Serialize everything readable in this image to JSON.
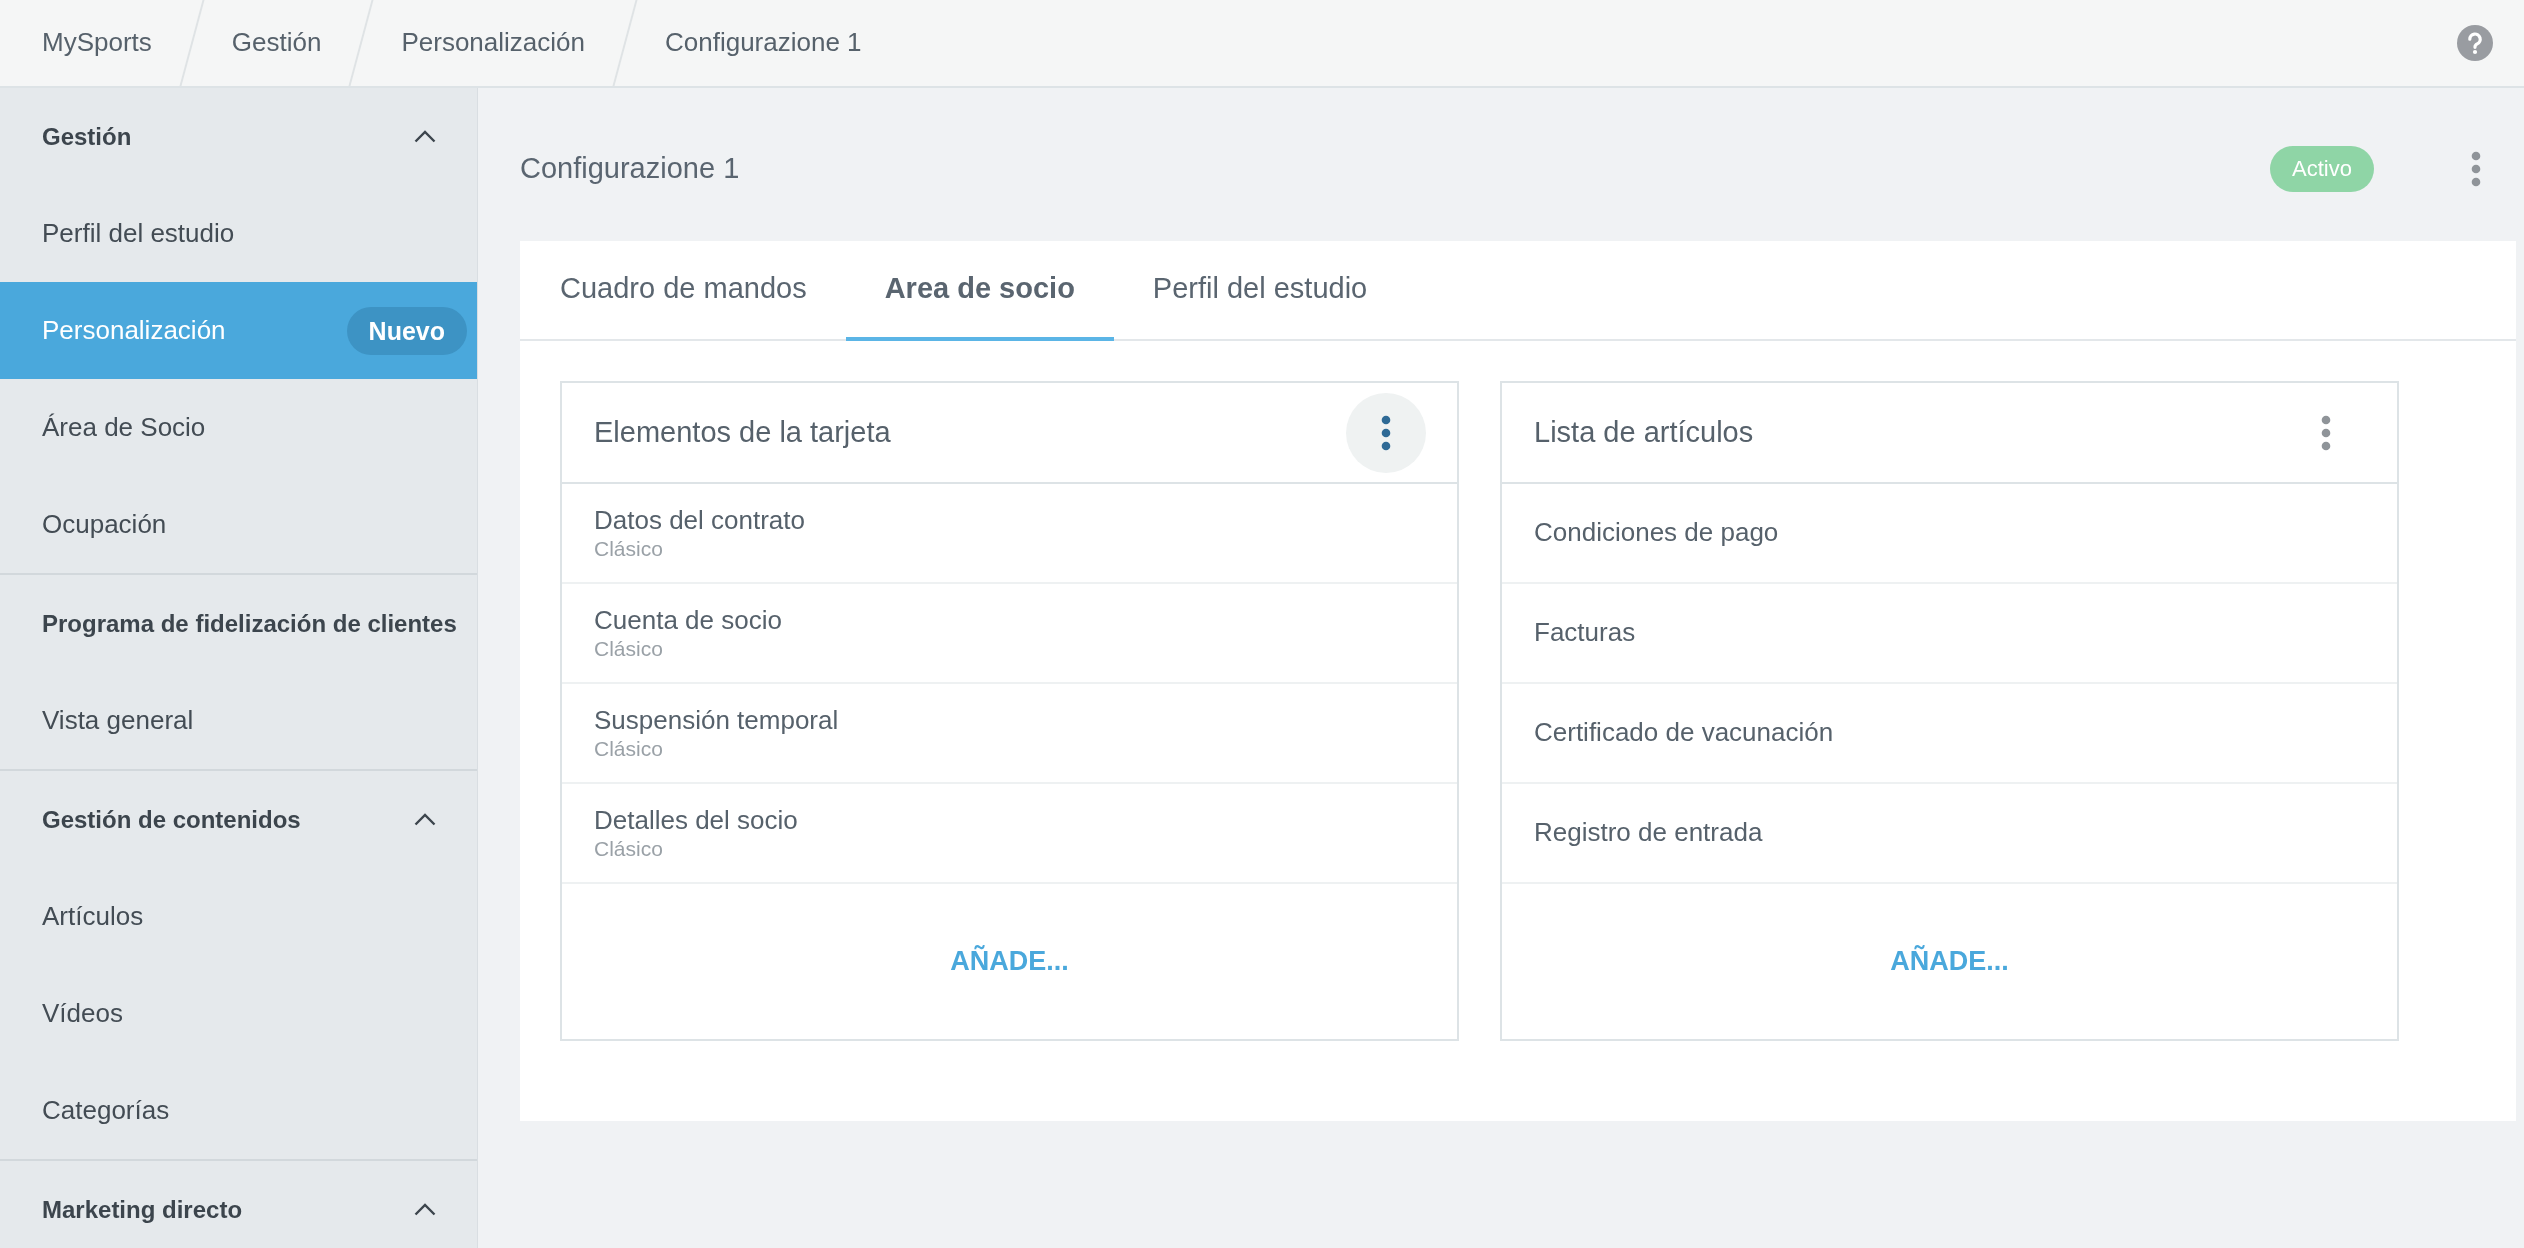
{
  "breadcrumbs": [
    "MySports",
    "Gestión",
    "Personalización",
    "Configurazione 1"
  ],
  "sidebar": {
    "sections": [
      {
        "title": "Gestión",
        "expanded": true,
        "items": [
          {
            "label": "Perfil del estudio",
            "selected": false
          },
          {
            "label": "Personalización",
            "selected": true,
            "badge": "Nuevo"
          },
          {
            "label": "Área de Socio",
            "selected": false
          },
          {
            "label": "Ocupación",
            "selected": false
          }
        ]
      },
      {
        "title": "Programa de fidelización de clientes",
        "items": [
          {
            "label": "Vista general",
            "selected": false
          }
        ]
      },
      {
        "title": "Gestión de contenidos",
        "expanded": true,
        "items": [
          {
            "label": "Artículos",
            "selected": false
          },
          {
            "label": "Vídeos",
            "selected": false
          },
          {
            "label": "Categorías",
            "selected": false
          }
        ]
      },
      {
        "title": "Marketing directo",
        "expanded": true
      }
    ]
  },
  "page": {
    "title": "Configurazione 1",
    "status": "Activo"
  },
  "tabs": [
    {
      "label": "Cuadro de mandos",
      "selected": false
    },
    {
      "label": "Area de socio",
      "selected": true
    },
    {
      "label": "Perfil del estudio",
      "selected": false
    }
  ],
  "cards": [
    {
      "title": "Elementos de la tarjeta",
      "menu_focused": true,
      "rows": [
        {
          "title": "Datos del contrato",
          "subtitle": "Clásico"
        },
        {
          "title": "Cuenta de socio",
          "subtitle": "Clásico"
        },
        {
          "title": "Suspensión temporal",
          "subtitle": "Clásico"
        },
        {
          "title": "Detalles del socio",
          "subtitle": "Clásico"
        }
      ],
      "add_label": "AÑADE..."
    },
    {
      "title": "Lista de artículos",
      "menu_focused": false,
      "rows": [
        {
          "title": "Condiciones de pago"
        },
        {
          "title": "Facturas"
        },
        {
          "title": "Certificado de vacunación"
        },
        {
          "title": "Registro de entrada"
        }
      ],
      "add_label": "AÑADE..."
    }
  ]
}
